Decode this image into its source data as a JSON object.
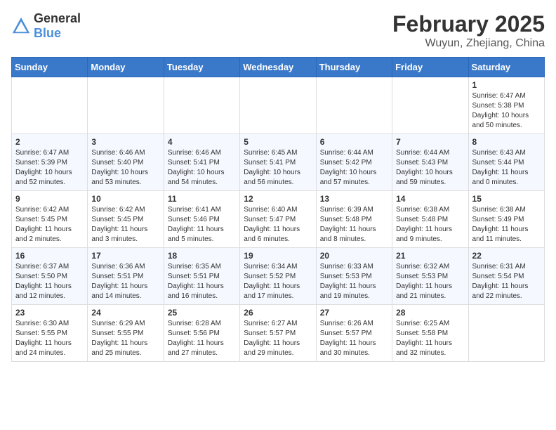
{
  "header": {
    "logo": {
      "general": "General",
      "blue": "Blue"
    },
    "title": "February 2025",
    "location": "Wuyun, Zhejiang, China"
  },
  "weekdays": [
    "Sunday",
    "Monday",
    "Tuesday",
    "Wednesday",
    "Thursday",
    "Friday",
    "Saturday"
  ],
  "weeks": [
    [
      {
        "day": "",
        "info": ""
      },
      {
        "day": "",
        "info": ""
      },
      {
        "day": "",
        "info": ""
      },
      {
        "day": "",
        "info": ""
      },
      {
        "day": "",
        "info": ""
      },
      {
        "day": "",
        "info": ""
      },
      {
        "day": "1",
        "info": "Sunrise: 6:47 AM\nSunset: 5:38 PM\nDaylight: 10 hours\nand 50 minutes."
      }
    ],
    [
      {
        "day": "2",
        "info": "Sunrise: 6:47 AM\nSunset: 5:39 PM\nDaylight: 10 hours\nand 52 minutes."
      },
      {
        "day": "3",
        "info": "Sunrise: 6:46 AM\nSunset: 5:40 PM\nDaylight: 10 hours\nand 53 minutes."
      },
      {
        "day": "4",
        "info": "Sunrise: 6:46 AM\nSunset: 5:41 PM\nDaylight: 10 hours\nand 54 minutes."
      },
      {
        "day": "5",
        "info": "Sunrise: 6:45 AM\nSunset: 5:41 PM\nDaylight: 10 hours\nand 56 minutes."
      },
      {
        "day": "6",
        "info": "Sunrise: 6:44 AM\nSunset: 5:42 PM\nDaylight: 10 hours\nand 57 minutes."
      },
      {
        "day": "7",
        "info": "Sunrise: 6:44 AM\nSunset: 5:43 PM\nDaylight: 10 hours\nand 59 minutes."
      },
      {
        "day": "8",
        "info": "Sunrise: 6:43 AM\nSunset: 5:44 PM\nDaylight: 11 hours\nand 0 minutes."
      }
    ],
    [
      {
        "day": "9",
        "info": "Sunrise: 6:42 AM\nSunset: 5:45 PM\nDaylight: 11 hours\nand 2 minutes."
      },
      {
        "day": "10",
        "info": "Sunrise: 6:42 AM\nSunset: 5:45 PM\nDaylight: 11 hours\nand 3 minutes."
      },
      {
        "day": "11",
        "info": "Sunrise: 6:41 AM\nSunset: 5:46 PM\nDaylight: 11 hours\nand 5 minutes."
      },
      {
        "day": "12",
        "info": "Sunrise: 6:40 AM\nSunset: 5:47 PM\nDaylight: 11 hours\nand 6 minutes."
      },
      {
        "day": "13",
        "info": "Sunrise: 6:39 AM\nSunset: 5:48 PM\nDaylight: 11 hours\nand 8 minutes."
      },
      {
        "day": "14",
        "info": "Sunrise: 6:38 AM\nSunset: 5:48 PM\nDaylight: 11 hours\nand 9 minutes."
      },
      {
        "day": "15",
        "info": "Sunrise: 6:38 AM\nSunset: 5:49 PM\nDaylight: 11 hours\nand 11 minutes."
      }
    ],
    [
      {
        "day": "16",
        "info": "Sunrise: 6:37 AM\nSunset: 5:50 PM\nDaylight: 11 hours\nand 12 minutes."
      },
      {
        "day": "17",
        "info": "Sunrise: 6:36 AM\nSunset: 5:51 PM\nDaylight: 11 hours\nand 14 minutes."
      },
      {
        "day": "18",
        "info": "Sunrise: 6:35 AM\nSunset: 5:51 PM\nDaylight: 11 hours\nand 16 minutes."
      },
      {
        "day": "19",
        "info": "Sunrise: 6:34 AM\nSunset: 5:52 PM\nDaylight: 11 hours\nand 17 minutes."
      },
      {
        "day": "20",
        "info": "Sunrise: 6:33 AM\nSunset: 5:53 PM\nDaylight: 11 hours\nand 19 minutes."
      },
      {
        "day": "21",
        "info": "Sunrise: 6:32 AM\nSunset: 5:53 PM\nDaylight: 11 hours\nand 21 minutes."
      },
      {
        "day": "22",
        "info": "Sunrise: 6:31 AM\nSunset: 5:54 PM\nDaylight: 11 hours\nand 22 minutes."
      }
    ],
    [
      {
        "day": "23",
        "info": "Sunrise: 6:30 AM\nSunset: 5:55 PM\nDaylight: 11 hours\nand 24 minutes."
      },
      {
        "day": "24",
        "info": "Sunrise: 6:29 AM\nSunset: 5:55 PM\nDaylight: 11 hours\nand 25 minutes."
      },
      {
        "day": "25",
        "info": "Sunrise: 6:28 AM\nSunset: 5:56 PM\nDaylight: 11 hours\nand 27 minutes."
      },
      {
        "day": "26",
        "info": "Sunrise: 6:27 AM\nSunset: 5:57 PM\nDaylight: 11 hours\nand 29 minutes."
      },
      {
        "day": "27",
        "info": "Sunrise: 6:26 AM\nSunset: 5:57 PM\nDaylight: 11 hours\nand 30 minutes."
      },
      {
        "day": "28",
        "info": "Sunrise: 6:25 AM\nSunset: 5:58 PM\nDaylight: 11 hours\nand 32 minutes."
      },
      {
        "day": "",
        "info": ""
      }
    ]
  ]
}
